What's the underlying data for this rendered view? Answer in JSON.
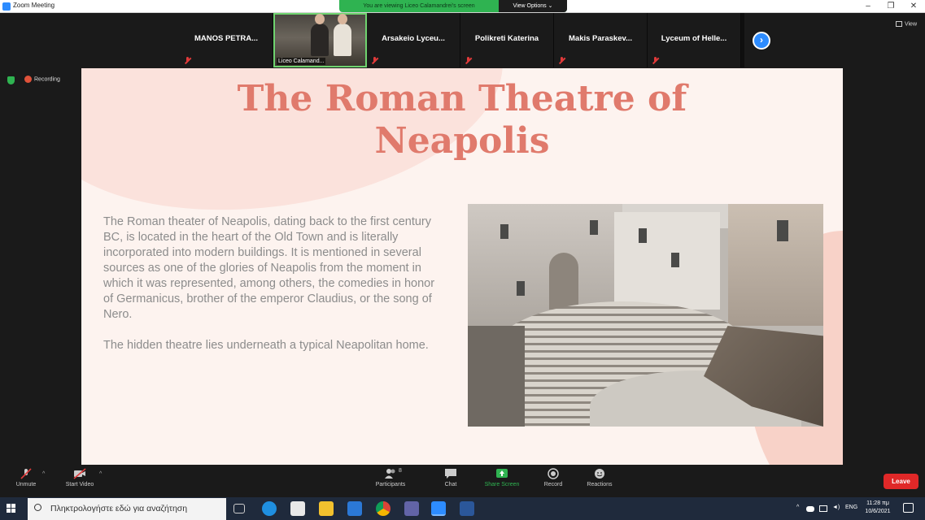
{
  "window": {
    "title": "Zoom Meeting",
    "controls": [
      "–",
      "❐",
      "✕"
    ]
  },
  "share_banner": {
    "message": "You are viewing Liceo Calamandrei's screen",
    "options_label": "View Options ⌄"
  },
  "view_label": "View",
  "recording_label": "Recording",
  "participants": [
    {
      "name": "MANOS PETRA...",
      "muted": true
    },
    {
      "name": "Liceo Calamand...",
      "video": true,
      "muted": false
    },
    {
      "name": "Arsakeio Lyceu...",
      "muted": true
    },
    {
      "name": "Polikreti Katerina",
      "muted": true
    },
    {
      "name": "Makis Paraskev...",
      "muted": true
    },
    {
      "name": "Lyceum of Helle...",
      "muted": true
    }
  ],
  "slide": {
    "title_line1": "The Roman Theatre of",
    "title_line2": "Neapolis",
    "paragraph1": "The Roman theater of Neapolis, dating back to the first century BC, is located in the heart of the Old Town and is literally incorporated into modern buildings. It is mentioned in several sources as one of the glories of Neapolis from the moment in which it was represented, among others, the comedies in honor of Germanicus, brother of the emperor Claudius, or the song of Nero.",
    "paragraph2": "The hidden theatre lies underneath a typical Neapolitan home."
  },
  "toolbar": {
    "unmute": "Unmute",
    "start_video": "Start Video",
    "participants": "Participants",
    "participants_count": "8",
    "chat": "Chat",
    "share_screen": "Share Screen",
    "record": "Record",
    "reactions": "Reactions",
    "leave": "Leave"
  },
  "taskbar": {
    "search_placeholder": "Πληκτρολογήστε εδώ για αναζήτηση",
    "language": "ENG",
    "time": "11:28 πμ",
    "date": "10/6/2021"
  },
  "colors": {
    "accent": "#2d8cff",
    "share_green": "#2fb351",
    "leave_red": "#e02828",
    "slide_title": "#e07a6c",
    "slide_bg": "#fdf3ef"
  }
}
